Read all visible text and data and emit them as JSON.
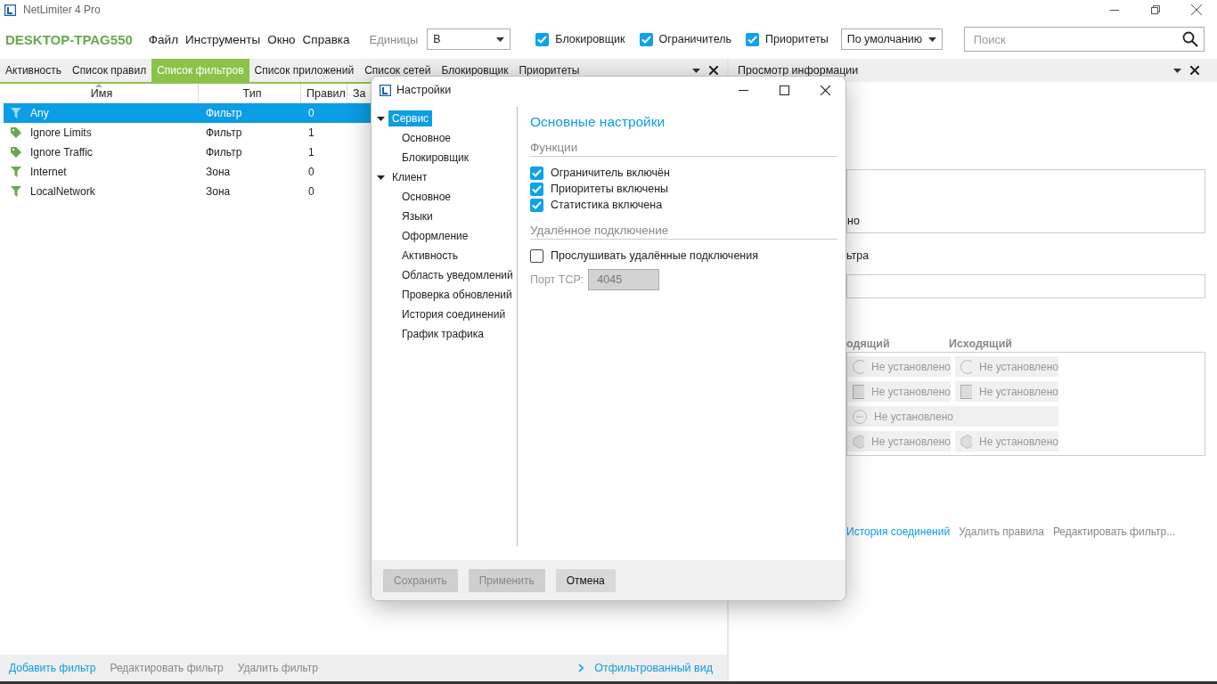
{
  "window": {
    "title": "NetLimiter 4 Pro"
  },
  "toolbar": {
    "host": "DESKTOP-TPAG550",
    "menu": [
      "Файл",
      "Инструменты",
      "Окно",
      "Справка"
    ],
    "units_label": "Единицы",
    "units_value": "B",
    "toggles": [
      {
        "label": "Блокировщик",
        "checked": true
      },
      {
        "label": "Ограничитель",
        "checked": true
      },
      {
        "label": "Приоритеты",
        "checked": true
      }
    ],
    "profile": "По умолчанию",
    "search": {
      "placeholder": "Поиск"
    }
  },
  "left_panel": {
    "tabs": [
      {
        "label": "Активность",
        "selected": false
      },
      {
        "label": "Список правил",
        "selected": false
      },
      {
        "label": "Список фильтров",
        "selected": true
      },
      {
        "label": "Список приложений",
        "selected": false
      },
      {
        "label": "Список сетей",
        "selected": false
      },
      {
        "label": "Блокировщик",
        "selected": false
      },
      {
        "label": "Приоритеты",
        "selected": false
      }
    ],
    "columns": [
      "Имя",
      "Тип",
      "Правил",
      "За"
    ],
    "rows": [
      {
        "kind": "funnel",
        "name": "Any",
        "type": "Фильтр",
        "rules": "0",
        "selected": true
      },
      {
        "kind": "tag",
        "name": "Ignore Limits",
        "type": "Фильтр",
        "rules": "1",
        "selected": false
      },
      {
        "kind": "tag",
        "name": "Ignore Traffic",
        "type": "Фильтр",
        "rules": "1",
        "selected": false
      },
      {
        "kind": "funnel",
        "name": "Internet",
        "type": "Зона",
        "rules": "0",
        "selected": false
      },
      {
        "kind": "funnel",
        "name": "LocalNetwork",
        "type": "Зона",
        "rules": "0",
        "selected": false
      }
    ],
    "actions": [
      {
        "label": "Добавить фильтр",
        "enabled": true
      },
      {
        "label": "Редактировать фильтр",
        "enabled": false
      },
      {
        "label": "Удалить фильтр",
        "enabled": false
      }
    ],
    "view_link": "Отфильтрованный вид"
  },
  "right_panel": {
    "title": "Просмотр информации",
    "name_value": "но",
    "filter_label": "ьтра",
    "columns": [
      "одящий",
      "Исходящий"
    ],
    "rule_rows": [
      {
        "kind": "radio",
        "cells": [
          "Не установлено",
          "Не установлено"
        ]
      },
      {
        "kind": "square",
        "cells": [
          "Не установлено",
          "Не установлено"
        ]
      },
      {
        "kind": "minus",
        "cells": [
          "Не установлено"
        ]
      },
      {
        "kind": "hex",
        "cells": [
          "Не установлено",
          "Не установлено"
        ]
      }
    ],
    "links": [
      {
        "label": "История соединений",
        "enabled": true
      },
      {
        "label": "Удалить правила",
        "enabled": false
      },
      {
        "label": "Редактировать фильтр...",
        "enabled": false
      }
    ]
  },
  "dialog": {
    "title": "Настройки",
    "tree": [
      {
        "label": "Сервис",
        "expanded": true,
        "selected": true,
        "children": [
          {
            "label": "Основное",
            "selected": false
          },
          {
            "label": "Блокировщик",
            "selected": false
          }
        ]
      },
      {
        "label": "Клиент",
        "expanded": true,
        "selected": false,
        "children": [
          {
            "label": "Основное",
            "selected": false
          },
          {
            "label": "Языки",
            "selected": false
          },
          {
            "label": "Оформление",
            "selected": false
          },
          {
            "label": "Активность",
            "selected": false
          },
          {
            "label": "Область уведомлений",
            "selected": false
          },
          {
            "label": "Проверка обновлений",
            "selected": false
          },
          {
            "label": "История соединений",
            "selected": false
          },
          {
            "label": "График трафика",
            "selected": false
          }
        ]
      }
    ],
    "heading": "Основные настройки",
    "sections": [
      {
        "title": "Функции",
        "options": [
          {
            "label": "Ограничитель включён",
            "checked": true
          },
          {
            "label": "Приоритеты включены",
            "checked": true
          },
          {
            "label": "Статистика включена",
            "checked": true
          }
        ]
      },
      {
        "title": "Удалённое подключение",
        "options": [
          {
            "label": "Прослушивать удалённые подключения",
            "checked": false
          }
        ],
        "port": {
          "label": "Порт TCP:",
          "value": "4045",
          "disabled": true
        }
      }
    ],
    "buttons": [
      {
        "label": "Сохранить",
        "disabled": true
      },
      {
        "label": "Применить",
        "disabled": true
      },
      {
        "label": "Отмена",
        "disabled": false
      }
    ]
  }
}
